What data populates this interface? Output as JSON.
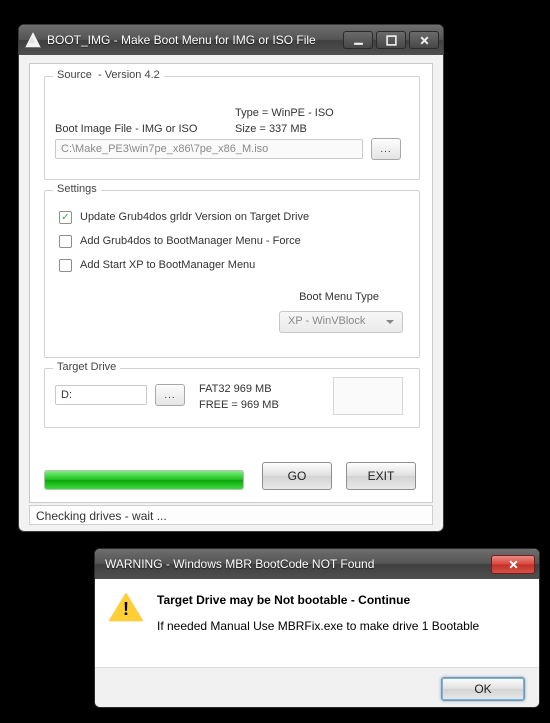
{
  "main": {
    "title": "BOOT_IMG - Make Boot Menu for IMG or ISO File",
    "source": {
      "legend": "Source",
      "version": "- Version 4.2",
      "type_label": "Type = ",
      "type_value": "WinPE - ISO",
      "size_label": "Size  = ",
      "size_value": "337 MB",
      "file_label": "Boot Image File - IMG or ISO",
      "file_path": "C:\\Make_PE3\\win7pe_x86\\7pe_x86_M.iso",
      "browse": "..."
    },
    "settings": {
      "legend": "Settings",
      "opts": [
        {
          "label": "Update Grub4dos grldr Version on Target Drive",
          "checked": true
        },
        {
          "label": "Add Grub4dos to BootManager Menu - Force",
          "checked": false
        },
        {
          "label": "Add Start XP   to BootManager Menu",
          "checked": false
        }
      ],
      "bootmenu_label": "Boot Menu Type",
      "bootmenu_value": "XP - WinVBlock"
    },
    "target": {
      "legend": "Target Drive",
      "drive": "D:",
      "browse": "...",
      "fs_line": "FAT32    969 MB",
      "free_line": "FREE  = 969 MB"
    },
    "go": "GO",
    "exit": "EXIT",
    "status": "Checking drives - wait ..."
  },
  "dialog": {
    "title": "WARNING - Windows MBR BootCode NOT Found",
    "line1": "Target Drive may be Not bootable - Continue",
    "line2": "If needed Manual Use MBRFix.exe to make drive 1 Bootable",
    "ok": "OK"
  }
}
